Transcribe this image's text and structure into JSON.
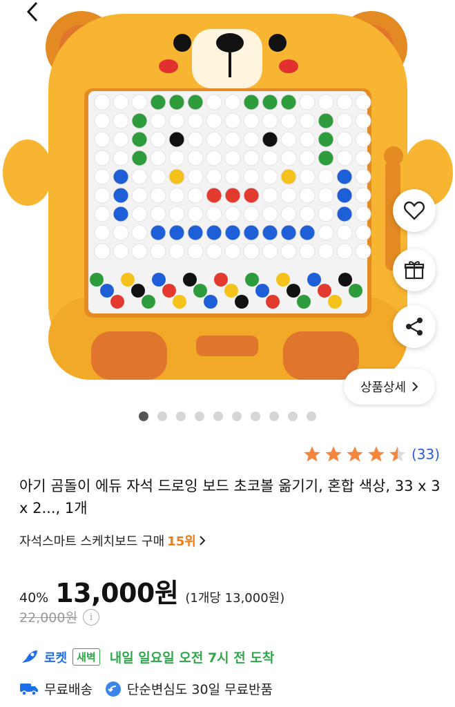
{
  "product_image": {
    "alt": "곰돌이 자석 드로잉 보드",
    "colors": {
      "frame": "#F8B531",
      "frame_dark": "#E48A22",
      "ear": "#E0752E",
      "board": "#F3F3F3"
    }
  },
  "actions": {
    "wishlist_icon": "heart-icon",
    "gift_icon": "gift-icon",
    "share_icon": "share-icon",
    "detail_label": "상품상세"
  },
  "gallery": {
    "total": 10,
    "active_index": 0
  },
  "rating": {
    "stars": 4.5,
    "count_text": "(33)"
  },
  "product": {
    "title": "아기 곰돌이 에듀 자석 드로잉 보드 초코볼 옮기기, 혼합 색상, 33 x 3 x 2..., 1개"
  },
  "ranking": {
    "category": "자석스마트 스케치보드 구매",
    "rank": "15위"
  },
  "pricing": {
    "discount": "40%",
    "price": "13,000원",
    "unit_price": "(1개당 13,000원)",
    "original_price": "22,000원"
  },
  "delivery": {
    "rocket_label": "로켓",
    "dawn_label": "새벽",
    "arrival": "내일 일요일 오전 7시 전 도착",
    "free_shipping": "무료배송",
    "free_return": "단순변심도 30일 무료반품"
  },
  "theme": {
    "accent_orange": "#F07A10",
    "link_blue": "#2A5BD7",
    "rocket_blue": "#1D6EE8",
    "dawn_green": "#2FA84A",
    "star_orange": "#F5843C"
  }
}
